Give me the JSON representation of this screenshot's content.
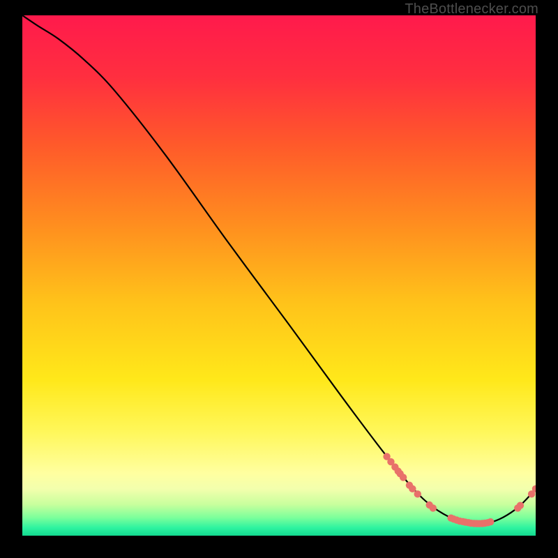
{
  "watermark": "TheBottlenecker.com",
  "colors": {
    "black": "#000000",
    "curve": "#000000",
    "point": "#e8716a",
    "watermark_text": "#4e4e4e"
  },
  "chart_data": {
    "type": "line",
    "title": "",
    "xlabel": "",
    "ylabel": "",
    "xlim": [
      0,
      100
    ],
    "ylim": [
      0,
      100
    ],
    "gradient_stops": [
      {
        "pct": 0.0,
        "color": "#ff1a4c"
      },
      {
        "pct": 0.12,
        "color": "#ff2f3f"
      },
      {
        "pct": 0.25,
        "color": "#ff5a2a"
      },
      {
        "pct": 0.4,
        "color": "#ff8d1f"
      },
      {
        "pct": 0.55,
        "color": "#ffc21a"
      },
      {
        "pct": 0.7,
        "color": "#ffe81a"
      },
      {
        "pct": 0.8,
        "color": "#fff75a"
      },
      {
        "pct": 0.88,
        "color": "#ffffa0"
      },
      {
        "pct": 0.91,
        "color": "#f3ffad"
      },
      {
        "pct": 0.94,
        "color": "#c8ff9d"
      },
      {
        "pct": 0.965,
        "color": "#7dff9b"
      },
      {
        "pct": 0.985,
        "color": "#2df3a0"
      },
      {
        "pct": 1.0,
        "color": "#13d98f"
      }
    ],
    "curve": [
      {
        "x": 0,
        "y": 100
      },
      {
        "x": 3,
        "y": 98
      },
      {
        "x": 7,
        "y": 95.5
      },
      {
        "x": 12,
        "y": 91.5
      },
      {
        "x": 18,
        "y": 85.5
      },
      {
        "x": 28,
        "y": 73
      },
      {
        "x": 40,
        "y": 56.5
      },
      {
        "x": 52,
        "y": 40.5
      },
      {
        "x": 62,
        "y": 27
      },
      {
        "x": 70,
        "y": 16.5
      },
      {
        "x": 76,
        "y": 9.2
      },
      {
        "x": 80,
        "y": 5.5
      },
      {
        "x": 84,
        "y": 3.2
      },
      {
        "x": 87,
        "y": 2.4
      },
      {
        "x": 90,
        "y": 2.3
      },
      {
        "x": 93,
        "y": 3.2
      },
      {
        "x": 96,
        "y": 5.0
      },
      {
        "x": 98,
        "y": 6.8
      },
      {
        "x": 100,
        "y": 9.0
      }
    ],
    "points": [
      {
        "x": 71.0,
        "y": 15.2
      },
      {
        "x": 71.8,
        "y": 14.2
      },
      {
        "x": 72.6,
        "y": 13.2
      },
      {
        "x": 73.2,
        "y": 12.4
      },
      {
        "x": 73.6,
        "y": 11.9
      },
      {
        "x": 74.2,
        "y": 11.2
      },
      {
        "x": 75.4,
        "y": 9.7
      },
      {
        "x": 76.0,
        "y": 9.0
      },
      {
        "x": 77.0,
        "y": 8.0
      },
      {
        "x": 79.3,
        "y": 5.9
      },
      {
        "x": 80.0,
        "y": 5.3
      },
      {
        "x": 83.5,
        "y": 3.4
      },
      {
        "x": 84.0,
        "y": 3.2
      },
      {
        "x": 84.6,
        "y": 3.0
      },
      {
        "x": 85.2,
        "y": 2.8
      },
      {
        "x": 85.8,
        "y": 2.7
      },
      {
        "x": 86.3,
        "y": 2.6
      },
      {
        "x": 86.9,
        "y": 2.5
      },
      {
        "x": 87.4,
        "y": 2.4
      },
      {
        "x": 88.0,
        "y": 2.35
      },
      {
        "x": 88.5,
        "y": 2.33
      },
      {
        "x": 89.0,
        "y": 2.32
      },
      {
        "x": 89.6,
        "y": 2.35
      },
      {
        "x": 90.1,
        "y": 2.4
      },
      {
        "x": 90.7,
        "y": 2.5
      },
      {
        "x": 91.2,
        "y": 2.65
      },
      {
        "x": 96.5,
        "y": 5.3
      },
      {
        "x": 97.0,
        "y": 5.8
      },
      {
        "x": 99.2,
        "y": 8.0
      },
      {
        "x": 100.0,
        "y": 9.0
      }
    ]
  }
}
